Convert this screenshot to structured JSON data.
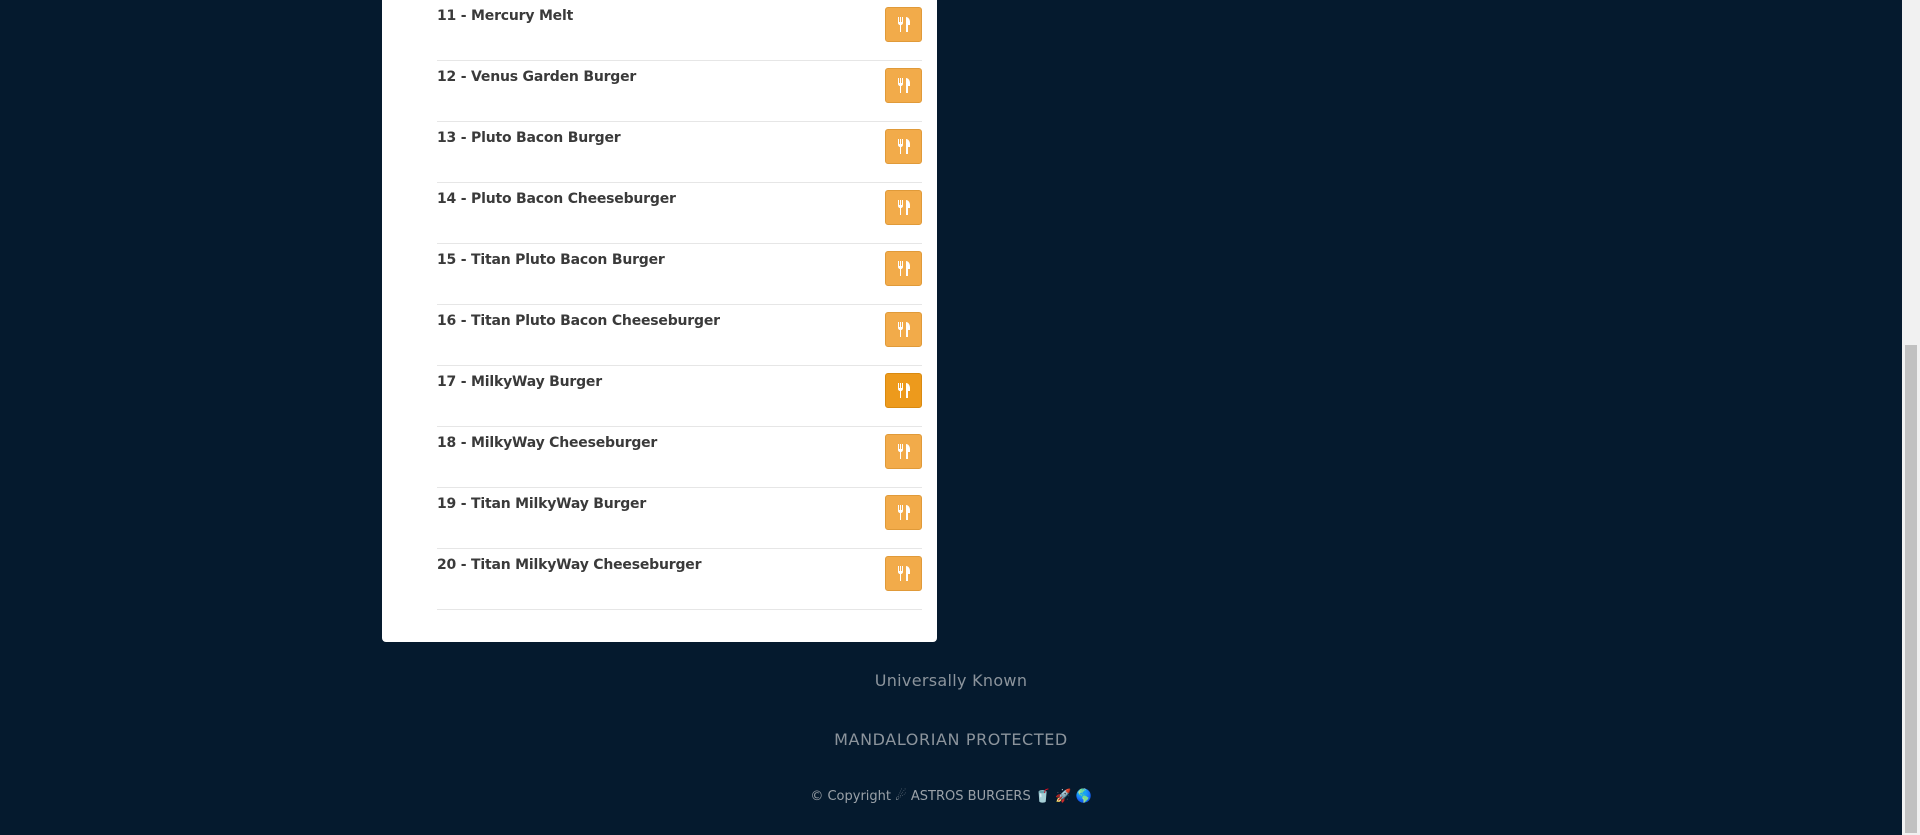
{
  "menu": {
    "items": [
      {
        "label": "11 - Mercury Melt",
        "active": false
      },
      {
        "label": "12 - Venus Garden Burger",
        "active": false
      },
      {
        "label": "13 - Pluto Bacon Burger",
        "active": false
      },
      {
        "label": "14 - Pluto Bacon Cheeseburger",
        "active": false
      },
      {
        "label": "15 - Titan Pluto Bacon Burger",
        "active": false
      },
      {
        "label": "16 - Titan Pluto Bacon Cheeseburger",
        "active": false
      },
      {
        "label": "17 - MilkyWay Burger",
        "active": true
      },
      {
        "label": "18 - MilkyWay Cheeseburger",
        "active": false
      },
      {
        "label": "19 - Titan MilkyWay Burger",
        "active": false
      },
      {
        "label": "20 - Titan MilkyWay Cheeseburger",
        "active": false
      }
    ],
    "order_icon": "utensils-icon"
  },
  "footer": {
    "tagline": "Universally Known",
    "protected": "MANDALORIAN PROTECTED",
    "copyright": "© Copyright ☄ ASTROS BURGERS 🥤 🚀 🌎"
  },
  "colors": {
    "background": "#051a2e",
    "card": "#ffffff",
    "button": "#f2ab4a",
    "button_active": "#ed9a1c"
  }
}
